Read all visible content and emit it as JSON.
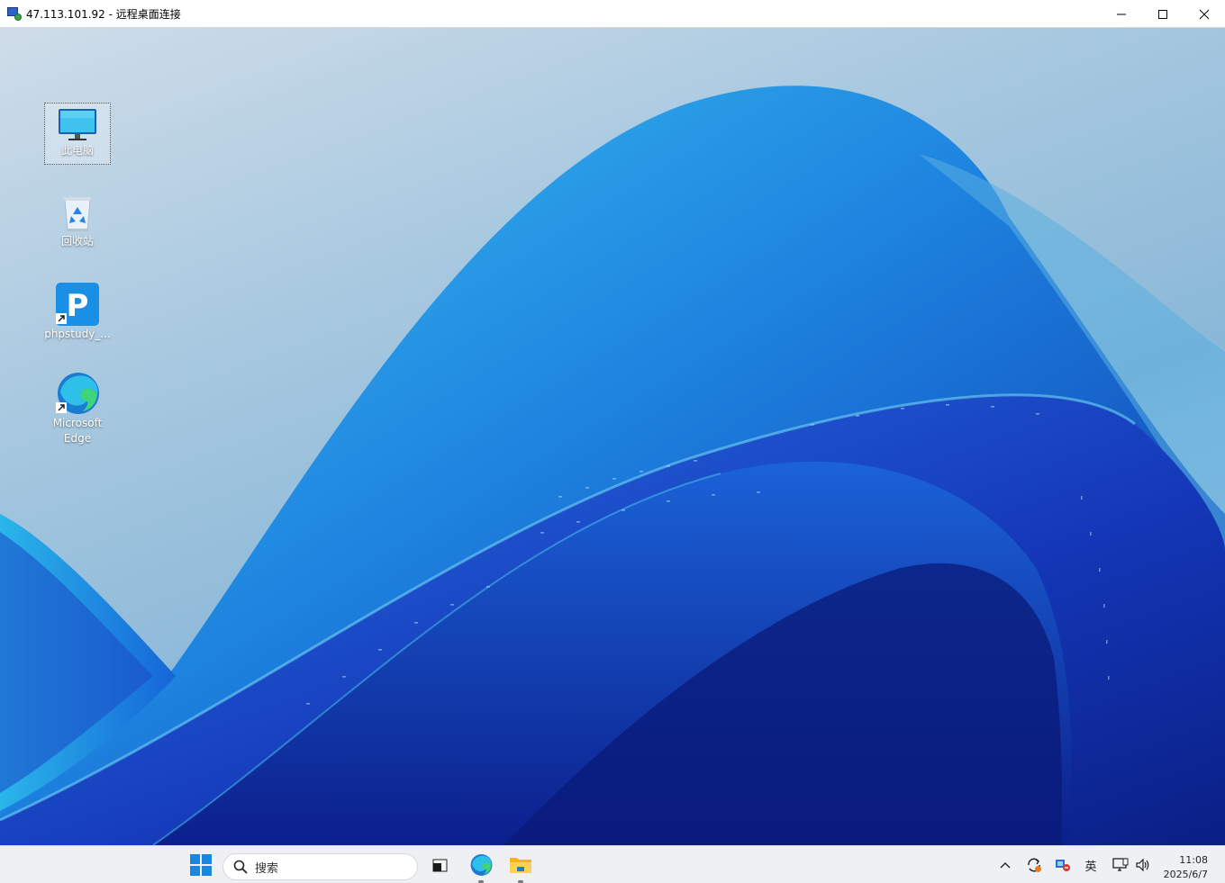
{
  "window": {
    "title": "47.113.101.92 - 远程桌面连接",
    "controls": [
      "minimize-icon",
      "maximize-icon",
      "close-icon"
    ]
  },
  "desktop": {
    "icons": [
      {
        "label": "此电脑",
        "icon": "this-pc-icon",
        "selected": true
      },
      {
        "label": "回收站",
        "icon": "recycle-bin-icon",
        "selected": false
      },
      {
        "label": "phpstudy_...",
        "icon": "phpstudy-icon",
        "selected": false
      },
      {
        "label": "Microsoft Edge",
        "icon": "edge-icon",
        "selected": false
      }
    ]
  },
  "taskbar": {
    "start": "windows-start-icon",
    "search": {
      "placeholder": "搜索"
    },
    "pinned": [
      "task-view-icon",
      "edge-icon",
      "file-explorer-icon"
    ],
    "tray": {
      "language": "英",
      "time": "11:08",
      "date": "2025/6/7"
    }
  },
  "colors": {
    "accent": "#0078d4",
    "wallpaper_dark": "#0d2fa0",
    "wallpaper_light": "#2aa7e8"
  }
}
